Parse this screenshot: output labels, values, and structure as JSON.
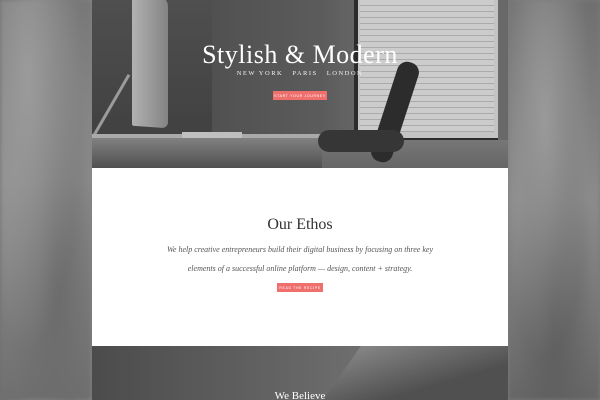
{
  "hero": {
    "title": "Stylish & Modern",
    "cities": [
      "NEW YORK",
      "PARIS",
      "LONDON"
    ],
    "button_label": "START YOUR JOURNEY"
  },
  "ethos": {
    "title": "Our Ethos",
    "text": "We help creative entrepreneurs build their digital business by focusing on three key elements of a successful online platform — design, content + strategy.",
    "button_label": "READ THE RECIPE"
  },
  "lower": {
    "title": "We Believe"
  },
  "colors": {
    "accent": "#ef6f6c",
    "background": "#ffffff"
  }
}
